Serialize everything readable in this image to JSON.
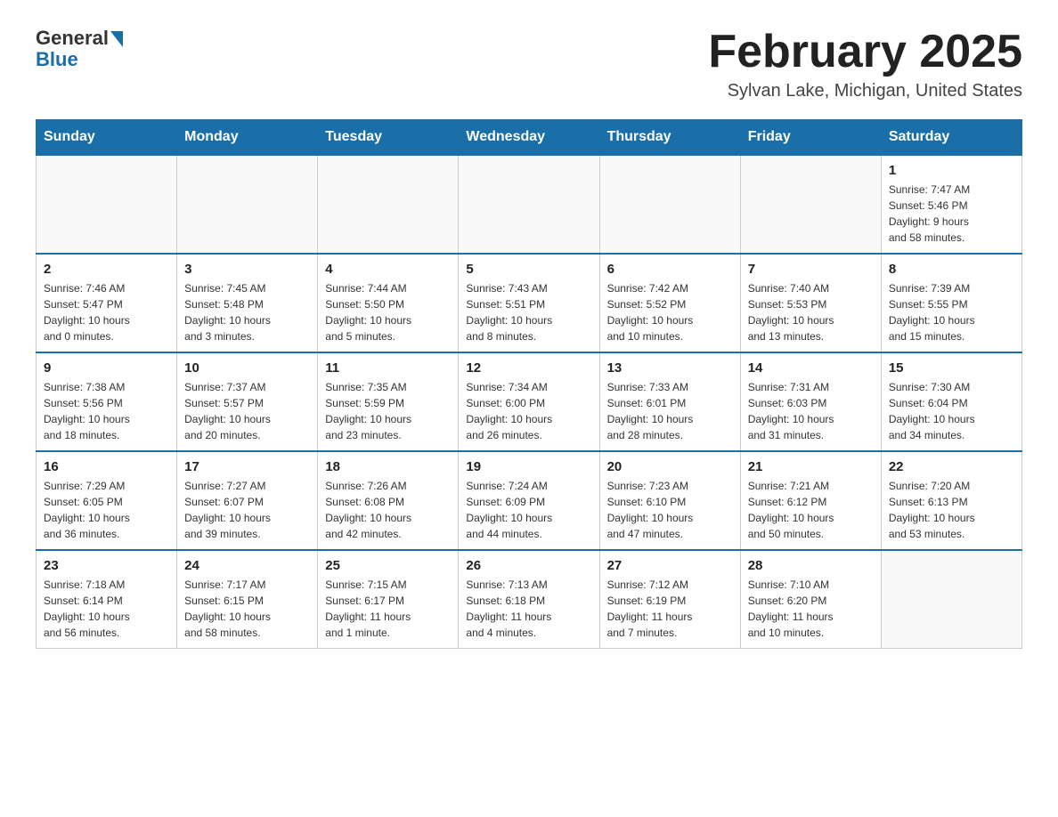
{
  "header": {
    "logo_general": "General",
    "logo_blue": "Blue",
    "month_title": "February 2025",
    "location": "Sylvan Lake, Michigan, United States"
  },
  "weekdays": [
    "Sunday",
    "Monday",
    "Tuesday",
    "Wednesday",
    "Thursday",
    "Friday",
    "Saturday"
  ],
  "weeks": [
    [
      {
        "day": "",
        "info": ""
      },
      {
        "day": "",
        "info": ""
      },
      {
        "day": "",
        "info": ""
      },
      {
        "day": "",
        "info": ""
      },
      {
        "day": "",
        "info": ""
      },
      {
        "day": "",
        "info": ""
      },
      {
        "day": "1",
        "info": "Sunrise: 7:47 AM\nSunset: 5:46 PM\nDaylight: 9 hours\nand 58 minutes."
      }
    ],
    [
      {
        "day": "2",
        "info": "Sunrise: 7:46 AM\nSunset: 5:47 PM\nDaylight: 10 hours\nand 0 minutes."
      },
      {
        "day": "3",
        "info": "Sunrise: 7:45 AM\nSunset: 5:48 PM\nDaylight: 10 hours\nand 3 minutes."
      },
      {
        "day": "4",
        "info": "Sunrise: 7:44 AM\nSunset: 5:50 PM\nDaylight: 10 hours\nand 5 minutes."
      },
      {
        "day": "5",
        "info": "Sunrise: 7:43 AM\nSunset: 5:51 PM\nDaylight: 10 hours\nand 8 minutes."
      },
      {
        "day": "6",
        "info": "Sunrise: 7:42 AM\nSunset: 5:52 PM\nDaylight: 10 hours\nand 10 minutes."
      },
      {
        "day": "7",
        "info": "Sunrise: 7:40 AM\nSunset: 5:53 PM\nDaylight: 10 hours\nand 13 minutes."
      },
      {
        "day": "8",
        "info": "Sunrise: 7:39 AM\nSunset: 5:55 PM\nDaylight: 10 hours\nand 15 minutes."
      }
    ],
    [
      {
        "day": "9",
        "info": "Sunrise: 7:38 AM\nSunset: 5:56 PM\nDaylight: 10 hours\nand 18 minutes."
      },
      {
        "day": "10",
        "info": "Sunrise: 7:37 AM\nSunset: 5:57 PM\nDaylight: 10 hours\nand 20 minutes."
      },
      {
        "day": "11",
        "info": "Sunrise: 7:35 AM\nSunset: 5:59 PM\nDaylight: 10 hours\nand 23 minutes."
      },
      {
        "day": "12",
        "info": "Sunrise: 7:34 AM\nSunset: 6:00 PM\nDaylight: 10 hours\nand 26 minutes."
      },
      {
        "day": "13",
        "info": "Sunrise: 7:33 AM\nSunset: 6:01 PM\nDaylight: 10 hours\nand 28 minutes."
      },
      {
        "day": "14",
        "info": "Sunrise: 7:31 AM\nSunset: 6:03 PM\nDaylight: 10 hours\nand 31 minutes."
      },
      {
        "day": "15",
        "info": "Sunrise: 7:30 AM\nSunset: 6:04 PM\nDaylight: 10 hours\nand 34 minutes."
      }
    ],
    [
      {
        "day": "16",
        "info": "Sunrise: 7:29 AM\nSunset: 6:05 PM\nDaylight: 10 hours\nand 36 minutes."
      },
      {
        "day": "17",
        "info": "Sunrise: 7:27 AM\nSunset: 6:07 PM\nDaylight: 10 hours\nand 39 minutes."
      },
      {
        "day": "18",
        "info": "Sunrise: 7:26 AM\nSunset: 6:08 PM\nDaylight: 10 hours\nand 42 minutes."
      },
      {
        "day": "19",
        "info": "Sunrise: 7:24 AM\nSunset: 6:09 PM\nDaylight: 10 hours\nand 44 minutes."
      },
      {
        "day": "20",
        "info": "Sunrise: 7:23 AM\nSunset: 6:10 PM\nDaylight: 10 hours\nand 47 minutes."
      },
      {
        "day": "21",
        "info": "Sunrise: 7:21 AM\nSunset: 6:12 PM\nDaylight: 10 hours\nand 50 minutes."
      },
      {
        "day": "22",
        "info": "Sunrise: 7:20 AM\nSunset: 6:13 PM\nDaylight: 10 hours\nand 53 minutes."
      }
    ],
    [
      {
        "day": "23",
        "info": "Sunrise: 7:18 AM\nSunset: 6:14 PM\nDaylight: 10 hours\nand 56 minutes."
      },
      {
        "day": "24",
        "info": "Sunrise: 7:17 AM\nSunset: 6:15 PM\nDaylight: 10 hours\nand 58 minutes."
      },
      {
        "day": "25",
        "info": "Sunrise: 7:15 AM\nSunset: 6:17 PM\nDaylight: 11 hours\nand 1 minute."
      },
      {
        "day": "26",
        "info": "Sunrise: 7:13 AM\nSunset: 6:18 PM\nDaylight: 11 hours\nand 4 minutes."
      },
      {
        "day": "27",
        "info": "Sunrise: 7:12 AM\nSunset: 6:19 PM\nDaylight: 11 hours\nand 7 minutes."
      },
      {
        "day": "28",
        "info": "Sunrise: 7:10 AM\nSunset: 6:20 PM\nDaylight: 11 hours\nand 10 minutes."
      },
      {
        "day": "",
        "info": ""
      }
    ]
  ]
}
